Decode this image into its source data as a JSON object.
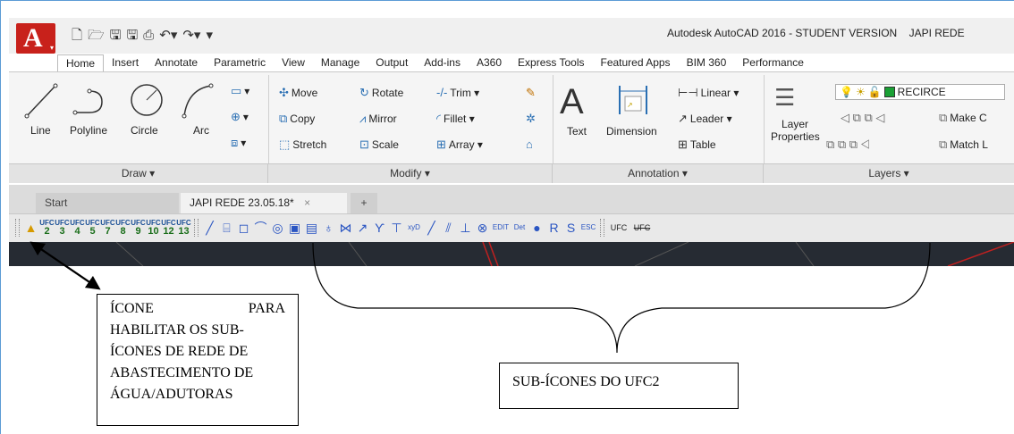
{
  "window": {
    "title": "Autodesk AutoCAD 2016 - STUDENT VERSION",
    "file_title": "JAPI REDE"
  },
  "app_button": {
    "logo": "A"
  },
  "qat": [
    "new-icon",
    "open-icon",
    "save-icon",
    "saveas-icon",
    "plot-icon",
    "undo-icon",
    "redo-icon",
    "customize-icon"
  ],
  "tabs": [
    "Home",
    "Insert",
    "Annotate",
    "Parametric",
    "View",
    "Manage",
    "Output",
    "Add-ins",
    "A360",
    "Express Tools",
    "Featured Apps",
    "BIM 360",
    "Performance"
  ],
  "ribbon": {
    "draw": {
      "line": "Line",
      "polyline": "Polyline",
      "circle": "Circle",
      "arc": "Arc",
      "panel": "Draw ▾"
    },
    "modify": {
      "move": "Move",
      "rotate": "Rotate",
      "trim": "Trim ▾",
      "copy": "Copy",
      "mirror": "Mirror",
      "fillet": "Fillet ▾",
      "stretch": "Stretch",
      "scale": "Scale",
      "array": "Array ▾",
      "panel": "Modify ▾"
    },
    "annotation": {
      "text": "Text",
      "dimension": "Dimension",
      "linear": "Linear ▾",
      "leader": "Leader ▾",
      "table": "Table",
      "panel": "Annotation ▾"
    },
    "layers": {
      "layer_properties": "Layer Properties",
      "current_layer": "RECIRCE",
      "make_current": "Make C",
      "match_layer": "Match L",
      "panel": "Layers ▾"
    }
  },
  "doc_tabs": {
    "start": "Start",
    "active": "JAPI REDE  23.05.18*",
    "close": "×",
    "new": "+"
  },
  "toolbar": {
    "ufc_buttons": [
      {
        "top": "UFC",
        "num": "2"
      },
      {
        "top": "UFC",
        "num": "3"
      },
      {
        "top": "UFC",
        "num": "4"
      },
      {
        "top": "UFC",
        "num": "5"
      },
      {
        "top": "UFC",
        "num": "7"
      },
      {
        "top": "UFC",
        "num": "8"
      },
      {
        "top": "UFC",
        "num": "9"
      },
      {
        "top": "UFC",
        "num": "10"
      },
      {
        "top": "UFC",
        "num": "12"
      },
      {
        "top": "UFC",
        "num": "13"
      }
    ],
    "sub_icons": [
      "╱",
      "⌸",
      "◻",
      "⌒",
      "◎",
      "▣",
      "▤",
      "♁",
      "⋈",
      "↗",
      "ϒ",
      "⊤",
      "xyD",
      "╱",
      "⫽",
      "⊥",
      "⊗",
      "EDIT",
      "Det",
      "●",
      "R",
      "S",
      "ESC"
    ],
    "right": [
      "UFC",
      "UFC"
    ]
  },
  "annotations": {
    "left_note": "ÍCONE PARA HABILITAR OS SUB-ÍCONES DE REDE DE ABASTECIMENTO DE ÁGUA/ADUTORAS",
    "left_lines": [
      "ÍCONE",
      "PARA",
      "HABILITAR OS SUB-",
      "ÍCONES DE REDE DE",
      "ABASTECIMENTO DE",
      "ÁGUA/ADUTORAS"
    ],
    "right_note": "SUB-ÍCONES DO UFC2"
  }
}
